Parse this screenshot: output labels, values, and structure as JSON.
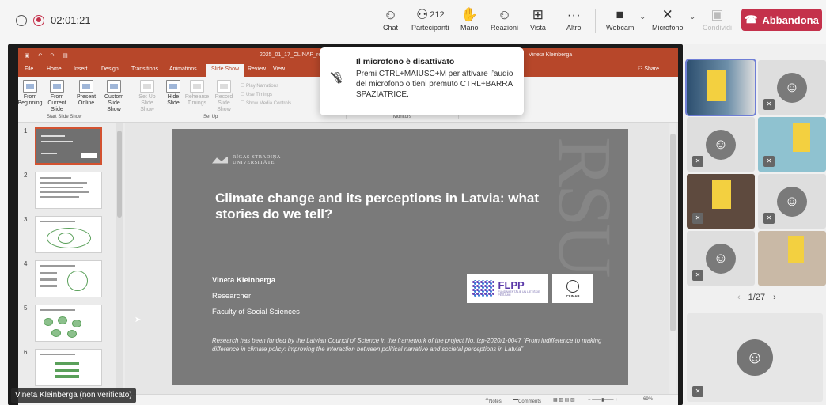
{
  "meeting": {
    "timer": "02:01:21",
    "controls": {
      "chat": "Chat",
      "participants": "Partecipanti",
      "participants_count": "212",
      "hand": "Mano",
      "reactions": "Reazioni",
      "view": "Vista",
      "more": "Altro",
      "webcam": "Webcam",
      "microphone": "Microfono",
      "share": "Condividi"
    },
    "leave_label": "Abbandona",
    "leave_color": "#c4314b"
  },
  "notification": {
    "title": "Il microfono è disattivato",
    "body": "Premi CTRL+MAIUSC+M per attivare l’audio del microfono o tieni premuto CTRL+BARRA SPAZIATRICE."
  },
  "presenter_label": "Vineta Kleinberga (non verificato)",
  "powerpoint": {
    "accent_color": "#b7472a",
    "filename": "2025_01_17_CLINAP_reu",
    "user": "Vineta Kleinberga",
    "tabs": [
      "File",
      "Home",
      "Insert",
      "Design",
      "Transitions",
      "Animations",
      "Slide Show",
      "Review",
      "View"
    ],
    "share": "Share",
    "ribbon": {
      "from_beginning": "From Beginning",
      "from_current": "From Current Slide",
      "present_online": "Present Online",
      "custom_show": "Custom Slide Show",
      "setup_show": "Set Up Slide Show",
      "hide_slide": "Hide Slide",
      "rehearse": "Rehearse Timings",
      "record": "Record Slide Show",
      "play_narrations": "Play Narrations",
      "use_timings": "Use Timings",
      "show_media": "Show Media Controls",
      "group_start": "Start Slide Show",
      "group_setup": "Set Up",
      "group_monitors": "Monitors"
    },
    "slide_numbers": [
      "1",
      "2",
      "3",
      "4",
      "5",
      "6"
    ],
    "slide": {
      "university_line1": "RĪGAS STRADIŅA",
      "university_line2": "UNIVERSITĀTE",
      "title": "Climate change and its perceptions in Latvia: what stories do we tell?",
      "name": "Vineta Kleinberga",
      "role": "Researcher",
      "faculty": "Faculty of Social Sciences",
      "funding_note": "Research has been funded by the Latvian Council of Science in the framework of the project No. lzp-2020/1-0047 “From indifference to making difference in climate policy: improving the interaction between political narrative and societal perceptions in Latvia”",
      "flpp": "FLPP",
      "flpp_sub": "FUNDAMENTĀLIE UN LIETIŠĶIE PĒTĪJUMI",
      "clinap": "CLINAP",
      "watermark": "RSU"
    },
    "status": {
      "notes": "Notes",
      "comments": "Comments",
      "zoom": "69%"
    }
  },
  "gallery": {
    "page": "1/27"
  }
}
